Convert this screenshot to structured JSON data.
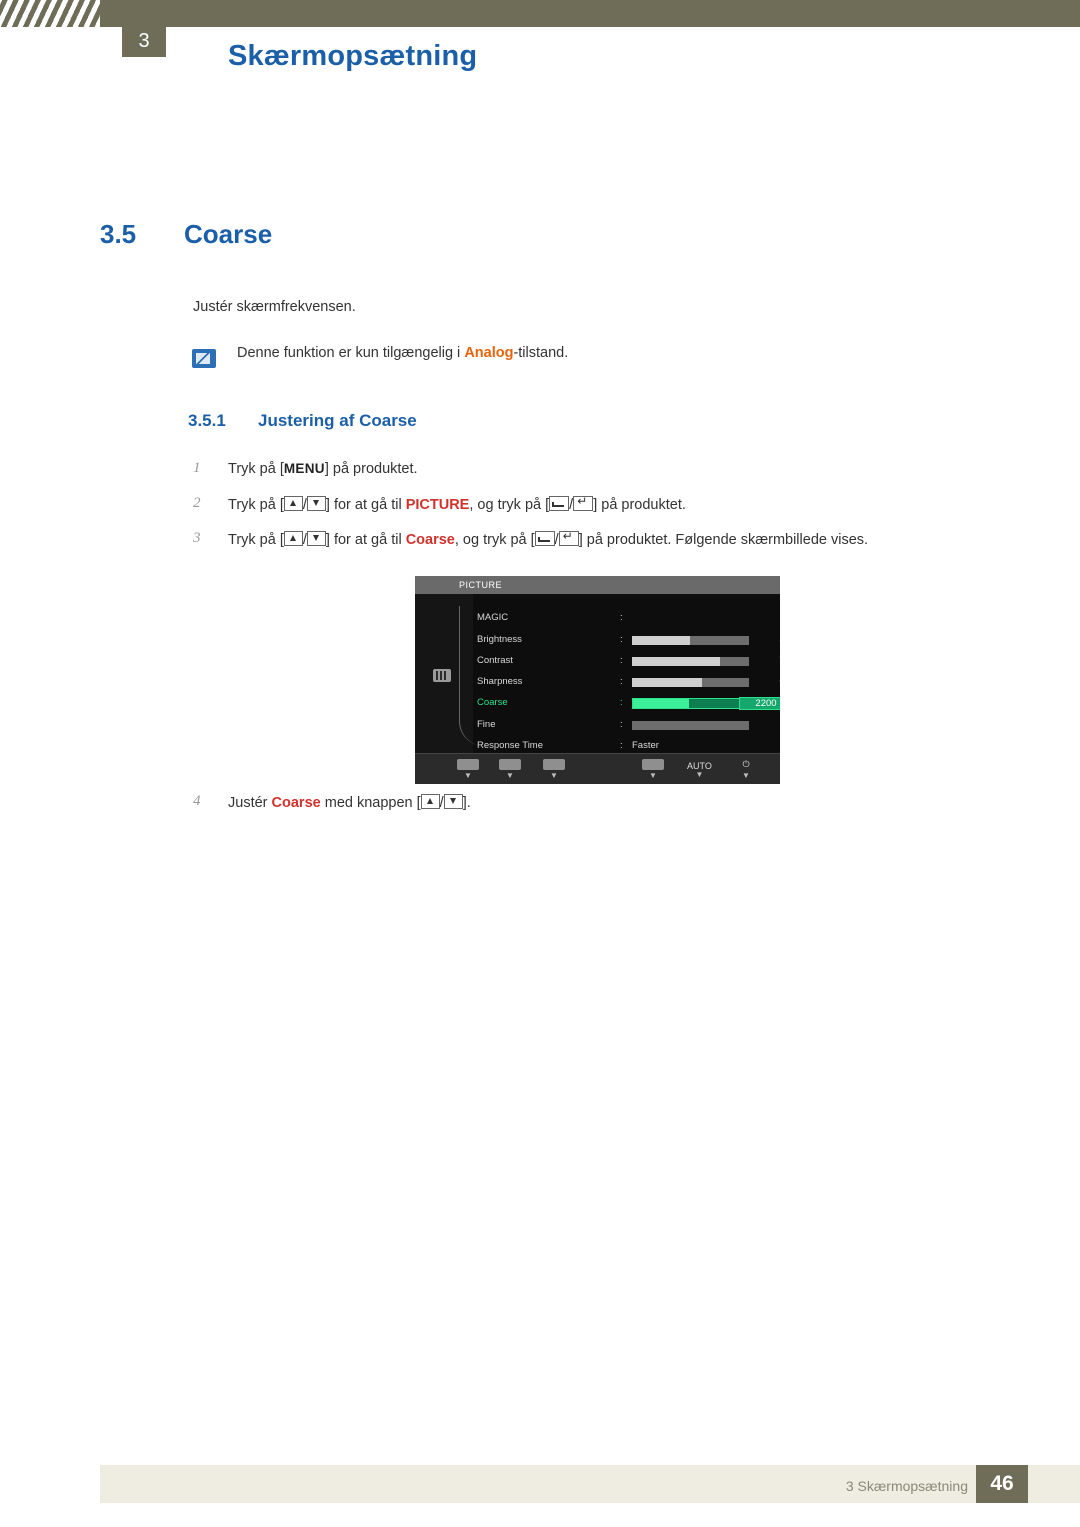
{
  "header": {
    "chapter_num": "3",
    "title": "Skærmopsætning"
  },
  "section": {
    "number": "3.5",
    "title": "Coarse",
    "intro": "Justér skærmfrekvensen.",
    "note": {
      "prefix": "Denne funktion er kun tilgængelig i ",
      "keyword": "Analog",
      "suffix": "-tilstand."
    }
  },
  "subsection": {
    "number": "3.5.1",
    "title": "Justering af Coarse"
  },
  "steps": [
    {
      "num": "1",
      "parts": [
        "Tryk på [",
        "MENU",
        "] på produktet."
      ]
    },
    {
      "num": "2",
      "parts": [
        "Tryk på [",
        "▲/▼",
        "] for at gå til ",
        "PICTURE",
        ", og tryk på [",
        "◄/↵",
        "] på produktet."
      ]
    },
    {
      "num": "3",
      "parts": [
        "Tryk på [",
        "▲/▼",
        "] for at gå til ",
        "Coarse",
        ", og tryk på [",
        "◄/↵",
        "] på produktet. Følgende skærmbillede vises."
      ]
    },
    {
      "num": "4",
      "parts": [
        "Justér ",
        "Coarse",
        " med knappen [",
        "▲/▼",
        "]."
      ]
    }
  ],
  "step_labels": {
    "s1_pre": "Tryk på",
    "s1_key": "MENU",
    "s1_post": "på produktet.",
    "s2_pre": "Tryk på",
    "s2_mid": "for at gå til",
    "s2_kw": "PICTURE",
    "s2_mid2": ", og tryk på",
    "s2_post": "på produktet.",
    "s3_pre": "Tryk på",
    "s3_mid": "for at gå til",
    "s3_kw": "Coarse",
    "s3_mid2": ", og tryk på",
    "s3_post": "på produktet. Følgende skærmbillede vises.",
    "s4_pre": "Justér",
    "s4_kw": "Coarse",
    "s4_post": "med knappen",
    "s4_end": "."
  },
  "osd": {
    "title": "PICTURE",
    "rows": [
      {
        "label": "MAGIC",
        "colon": ":",
        "type": "none",
        "value": ""
      },
      {
        "label": "Brightness",
        "colon": ":",
        "type": "bar",
        "value": "50",
        "fill_pct": 50
      },
      {
        "label": "Contrast",
        "colon": ":",
        "type": "bar",
        "value": "75",
        "fill_pct": 75
      },
      {
        "label": "Sharpness",
        "colon": ":",
        "type": "bar",
        "value": "60",
        "fill_pct": 60
      },
      {
        "label": "Coarse",
        "colon": ":",
        "type": "bar-selected",
        "value": "2200",
        "fill_pct": 48
      },
      {
        "label": "Fine",
        "colon": ":",
        "type": "bar",
        "value": "0",
        "fill_pct": 0
      },
      {
        "label": "Response Time",
        "colon": ":",
        "type": "text",
        "value": "Faster"
      }
    ],
    "buttons": [
      {
        "name": "left",
        "label": "",
        "sub": "▼"
      },
      {
        "name": "minus",
        "label": "",
        "sub": "▼"
      },
      {
        "name": "plus",
        "label": "",
        "sub": "▼"
      },
      {
        "name": "enter",
        "label": "",
        "sub": "▼"
      },
      {
        "name": "auto",
        "label": "AUTO",
        "sub": "▼"
      },
      {
        "name": "power",
        "label": "",
        "sub": "▼"
      }
    ]
  },
  "footer": {
    "text": "3 Skærmopsætning",
    "page": "46"
  },
  "colors": {
    "accent_blue": "#1b5fa8",
    "keyword_orange": "#e8630a",
    "keyword_red": "#d2322d",
    "header_band": "#6f6c58",
    "osd_highlight": "#2de08a"
  }
}
